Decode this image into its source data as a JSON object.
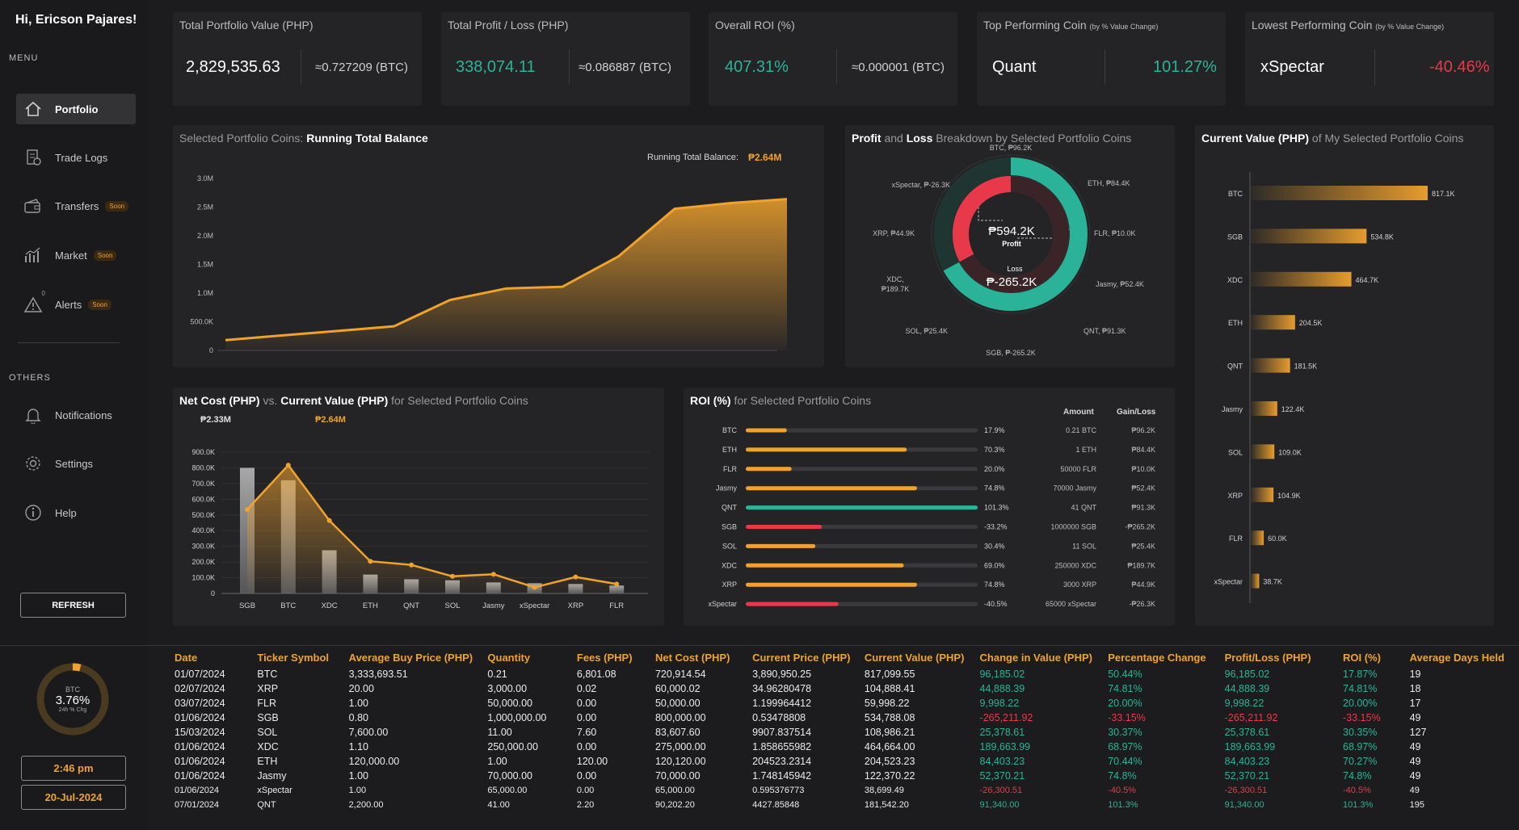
{
  "sidebar": {
    "greeting": "Hi, Ericson Pajares!",
    "menu_label": "MENU",
    "others_label": "OTHERS",
    "items": [
      {
        "label": "Portfolio",
        "soon": ""
      },
      {
        "label": "Trade Logs",
        "soon": ""
      },
      {
        "label": "Transfers",
        "soon": "Soon"
      },
      {
        "label": "Market",
        "soon": "Soon"
      },
      {
        "label": "Alerts",
        "soon": "Soon"
      }
    ],
    "alerts_badge": "0",
    "others": [
      {
        "label": "Notifications"
      },
      {
        "label": "Settings"
      },
      {
        "label": "Help"
      }
    ],
    "refresh_label": "REFRESH",
    "btc_ring": {
      "coin": "BTC",
      "pct": "3.76%",
      "caption": "24h % Chg",
      "value_pct": 3.76
    },
    "time": "2:46 pm",
    "date": "20-Jul-2024"
  },
  "kpis": [
    {
      "title": "Total Portfolio Value (PHP)",
      "subtitle": "",
      "main": "2,829,535.63",
      "side": "≈0.727209 (BTC)"
    },
    {
      "title": "Total Profit / Loss (PHP)",
      "subtitle": "",
      "main": "338,074.11",
      "side": "≈0.086887 (BTC)"
    },
    {
      "title": "Overall ROI (%)",
      "subtitle": "",
      "main": "407.31%",
      "side": "≈0.000001 (BTC)"
    },
    {
      "title": "Top Performing Coin ",
      "subtitle": "(by % Value Change)",
      "main": "Quant",
      "side": "101.27%"
    },
    {
      "title": "Lowest Performing Coin ",
      "subtitle": "(by % Value Change)",
      "main": "xSpectar",
      "side": "-40.46%"
    }
  ],
  "running_total": {
    "title_prefix": "Selected Portfolio Coins: ",
    "title_bold": "Running Total Balance",
    "label": "Running Total Balance:",
    "value": "₱2.64M"
  },
  "pl_breakdown": {
    "title_b1": "Profit",
    "title_mid": " and ",
    "title_b2": "Loss",
    "title_rest": " Breakdown by Selected Portfolio Coins",
    "profit_value": "₱594.2K",
    "profit_label": "Profit",
    "loss_label": "Loss",
    "loss_value": "₱-265.2K"
  },
  "current_value_panel": {
    "title_bold": "Current Value (PHP)",
    "title_rest": " of My Selected Portfolio Coins"
  },
  "net_cost_panel": {
    "title_b1": "Net Cost (PHP)",
    "title_vs": " vs. ",
    "title_b2": "Current Value (PHP)",
    "title_rest": " for Selected Portfolio Coins",
    "net_total": "₱2.33M",
    "current_total": "₱2.64M"
  },
  "roi_panel": {
    "title_bold": "ROI (%)",
    "title_rest": " for Selected Portfolio Coins",
    "col_amount": "Amount",
    "col_gain": "Gain/Loss"
  },
  "colors": {
    "accent": "#f0a22e",
    "green": "#2bb39a",
    "red": "#e8394a",
    "card": "#242427"
  },
  "chart_data": [
    {
      "type": "area",
      "title": "Running Total Balance",
      "y_ticks": [
        "3.0M",
        "2.5M",
        "2.0M",
        "1.5M",
        "1.0M",
        "500.0K",
        "0"
      ],
      "ylim": [
        0,
        3000000
      ],
      "values": [
        180000,
        260000,
        340000,
        420000,
        880000,
        1080000,
        1110000,
        1640000,
        2470000,
        2570000,
        2640000
      ]
    },
    {
      "type": "pie",
      "title": "Profit and Loss Breakdown by Selected Portfolio Coins",
      "slices": [
        {
          "label": "BTC, ₱96.2K",
          "value": 96.2
        },
        {
          "label": "ETH, ₱84.4K",
          "value": 84.4
        },
        {
          "label": "FLR, ₱10.0K",
          "value": 10.0
        },
        {
          "label": "Jasmy, ₱52.4K",
          "value": 52.4
        },
        {
          "label": "QNT, ₱91.3K",
          "value": 91.3
        },
        {
          "label": "SGB, ₱-265.2K",
          "value": -265.2
        },
        {
          "label": "SOL, ₱25.4K",
          "value": 25.4
        },
        {
          "label": "XDC, ₱189.7K",
          "value": 189.7
        },
        {
          "label": "XRP, ₱44.9K",
          "value": 44.9
        },
        {
          "label": "xSpectar, ₱-26.3K",
          "value": -26.3
        }
      ]
    },
    {
      "type": "bar",
      "title": "Current Value (PHP) of My Selected Portfolio Coins",
      "categories": [
        "BTC",
        "SGB",
        "XDC",
        "ETH",
        "QNT",
        "Jasmy",
        "SOL",
        "XRP",
        "FLR",
        "xSpectar"
      ],
      "values": [
        817.1,
        534.8,
        464.7,
        204.5,
        181.5,
        122.4,
        109.0,
        104.9,
        60.0,
        38.7
      ],
      "labels": [
        "817.1K",
        "534.8K",
        "464.7K",
        "204.5K",
        "181.5K",
        "122.4K",
        "109.0K",
        "104.9K",
        "60.0K",
        "38.7K"
      ]
    },
    {
      "type": "bar",
      "title": "Net Cost (PHP) vs. Current Value (PHP) for Selected Portfolio Coins",
      "categories": [
        "SGB",
        "BTC",
        "XDC",
        "ETH",
        "QNT",
        "SOL",
        "Jasmy",
        "xSpectar",
        "XRP",
        "FLR"
      ],
      "y_ticks": [
        "900.0K",
        "800.0K",
        "700.0K",
        "600.0K",
        "500.0K",
        "400.0K",
        "300.0K",
        "200.0K",
        "100.0K",
        "0"
      ],
      "ylim": [
        0,
        900000
      ],
      "series": [
        {
          "name": "Net Cost (PHP)",
          "values": [
            800000,
            720914.54,
            275000,
            120120,
            90202.2,
            83607.6,
            70000,
            65000,
            60000.02,
            50000
          ]
        },
        {
          "name": "Current Value (PHP)",
          "values": [
            534788.08,
            817099.55,
            464664,
            204523.23,
            181542.2,
            108986.21,
            122370.22,
            38699.49,
            104888.41,
            59998.22
          ]
        }
      ]
    },
    {
      "type": "bar",
      "title": "ROI (%) for Selected Portfolio Coins",
      "rows": [
        {
          "coin": "BTC",
          "roi": 17.9,
          "roi_label": "17.9%",
          "amount": "0.21 BTC",
          "gain": "₱96.2K"
        },
        {
          "coin": "ETH",
          "roi": 70.3,
          "roi_label": "70.3%",
          "amount": "1 ETH",
          "gain": "₱84.4K"
        },
        {
          "coin": "FLR",
          "roi": 20.0,
          "roi_label": "20.0%",
          "amount": "50000 FLR",
          "gain": "₱10.0K"
        },
        {
          "coin": "Jasmy",
          "roi": 74.8,
          "roi_label": "74.8%",
          "amount": "70000 Jasmy",
          "gain": "₱52.4K"
        },
        {
          "coin": "QNT",
          "roi": 101.3,
          "roi_label": "101.3%",
          "amount": "41 QNT",
          "gain": "₱91.3K"
        },
        {
          "coin": "SGB",
          "roi": -33.2,
          "roi_label": "-33.2%",
          "amount": "1000000 SGB",
          "gain": "-₱265.2K"
        },
        {
          "coin": "SOL",
          "roi": 30.4,
          "roi_label": "30.4%",
          "amount": "11 SOL",
          "gain": "₱25.4K"
        },
        {
          "coin": "XDC",
          "roi": 69.0,
          "roi_label": "69.0%",
          "amount": "250000 XDC",
          "gain": "₱189.7K"
        },
        {
          "coin": "XRP",
          "roi": 74.8,
          "roi_label": "74.8%",
          "amount": "3000 XRP",
          "gain": "₱44.9K"
        },
        {
          "coin": "xSpectar",
          "roi": -40.5,
          "roi_label": "-40.5%",
          "amount": "65000 xSpectar",
          "gain": "-₱26.3K"
        }
      ]
    }
  ],
  "table": {
    "headers": [
      "Date",
      "Ticker Symbol",
      "Average Buy Price (PHP)",
      "Quantity",
      "Fees (PHP)",
      "Net Cost (PHP)",
      "Current Price (PHP)",
      "Current Value (PHP)",
      "Change in Value (PHP)",
      "Percentage Change",
      "Profit/Loss (PHP)",
      "ROI (%)",
      "Average Days Held"
    ],
    "rows": [
      [
        "01/07/2024",
        "BTC",
        "3,333,693.51",
        "0.21",
        "6,801.08",
        "720,914.54",
        "3,890,950.25",
        "817,099.55",
        "96,185.02",
        "50.44%",
        "96,185.02",
        "17.87%",
        "19"
      ],
      [
        "02/07/2024",
        "XRP",
        "20.00",
        "3,000.00",
        "0.02",
        "60,000.02",
        "34.96280478",
        "104,888.41",
        "44,888.39",
        "74.81%",
        "44,888.39",
        "74.81%",
        "18"
      ],
      [
        "03/07/2024",
        "FLR",
        "1.00",
        "50,000.00",
        "0.00",
        "50,000.00",
        "1.199964412",
        "59,998.22",
        "9,998.22",
        "20.00%",
        "9,998.22",
        "20.00%",
        "17"
      ],
      [
        "01/06/2024",
        "SGB",
        "0.80",
        "1,000,000.00",
        "0.00",
        "800,000.00",
        "0.53478808",
        "534,788.08",
        "-265,211.92",
        "-33.15%",
        "-265,211.92",
        "-33.15%",
        "49"
      ],
      [
        "15/03/2024",
        "SOL",
        "7,600.00",
        "11.00",
        "7.60",
        "83,607.60",
        "9907.837514",
        "108,986.21",
        "25,378.61",
        "30.37%",
        "25,378.61",
        "30.35%",
        "127"
      ],
      [
        "01/06/2024",
        "XDC",
        "1.10",
        "250,000.00",
        "0.00",
        "275,000.00",
        "1.858655982",
        "464,664.00",
        "189,663.99",
        "68.97%",
        "189,663.99",
        "68.97%",
        "49"
      ],
      [
        "01/06/2024",
        "ETH",
        "120,000.00",
        "1.00",
        "120.00",
        "120,120.00",
        "204523.2314",
        "204,523.23",
        "84,403.23",
        "70.44%",
        "84,403.23",
        "70.27%",
        "49"
      ],
      [
        "01/06/2024",
        "Jasmy",
        "1.00",
        "70,000.00",
        "0.00",
        "70,000.00",
        "1.748145942",
        "122,370.22",
        "52,370.21",
        "74.8%",
        "52,370.21",
        "74.8%",
        "49"
      ],
      [
        "01/06/2024",
        "xSpectar",
        "1.00",
        "65,000.00",
        "0.00",
        "65,000.00",
        "0.595376773",
        "38,699.49",
        "-26,300.51",
        "-40.5%",
        "-26,300.51",
        "-40.5%",
        "49"
      ],
      [
        "07/01/2024",
        "QNT",
        "2,200.00",
        "41.00",
        "2.20",
        "90,202.20",
        "4427.85848",
        "181,542.20",
        "91,340.00",
        "101.3%",
        "91,340.00",
        "101.3%",
        "195"
      ]
    ]
  }
}
